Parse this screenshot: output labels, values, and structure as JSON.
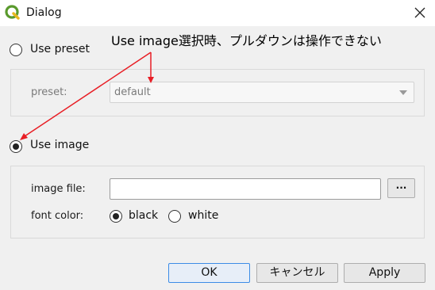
{
  "window": {
    "title": "Dialog",
    "app_icon": "qgis-logo-icon",
    "close_icon": "close-icon"
  },
  "preset_option": {
    "label": "Use preset",
    "checked": false,
    "preset_label": "preset:",
    "preset_value": "default",
    "enabled": false
  },
  "image_option": {
    "label": "Use image",
    "checked": true,
    "file_label": "image file:",
    "file_value": "",
    "browse_label": "···",
    "font_color_label": "font color:",
    "colors": [
      {
        "label": "black",
        "checked": true
      },
      {
        "label": "white",
        "checked": false
      }
    ]
  },
  "buttons": {
    "ok": "OK",
    "cancel": "キャンセル",
    "apply": "Apply"
  },
  "annotation": {
    "text": "Use image選択時、プルダウンは操作できない",
    "color": "#e81e25"
  },
  "colors": {
    "accent": "#3c8ce6",
    "qgis_green": "#5a9a2d"
  }
}
